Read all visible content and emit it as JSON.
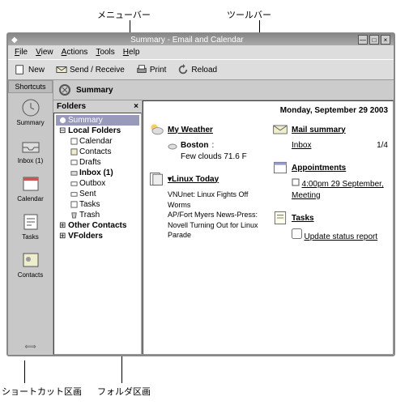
{
  "annotations": {
    "menubar": "メニューバー",
    "toolbar": "ツールバー",
    "shortcuts": "ショートカット区画",
    "folders": "フォルダ区画"
  },
  "window": {
    "title": "Summary - Email and Calendar"
  },
  "menu": {
    "file": "File",
    "view": "View",
    "actions": "Actions",
    "tools": "Tools",
    "help": "Help"
  },
  "tb": {
    "new": "New",
    "sendrecv": "Send / Receive",
    "print": "Print",
    "reload": "Reload"
  },
  "shortcuts": {
    "header": "Shortcuts",
    "items": [
      {
        "label": "Summary"
      },
      {
        "label": "Inbox (1)"
      },
      {
        "label": "Calendar"
      },
      {
        "label": "Tasks"
      },
      {
        "label": "Contacts"
      }
    ]
  },
  "summary": {
    "header": "Summary"
  },
  "folders": {
    "header": "Folders",
    "close": "×",
    "root": "Summary",
    "local": "Local Folders",
    "items": [
      {
        "label": "Calendar"
      },
      {
        "label": "Contacts"
      },
      {
        "label": "Drafts"
      },
      {
        "label": "Inbox (1)",
        "bold": true
      },
      {
        "label": "Outbox"
      },
      {
        "label": "Sent"
      },
      {
        "label": "Tasks"
      },
      {
        "label": "Trash"
      }
    ],
    "other": "Other Contacts",
    "vfolders": "VFolders"
  },
  "pane": {
    "date": "Monday, September 29 2003",
    "weather": {
      "title": "My Weather",
      "city": "Boston",
      "cond": "Few clouds 71.6 F"
    },
    "news": {
      "title": "▾Linux Today",
      "body": "VNUnet: Linux Fights Off Worms\nAP/Fort Myers News-Press: Novell Turning Out for Linux Parade"
    },
    "mail": {
      "title": "Mail summary",
      "folder": "Inbox",
      "count": "1/4"
    },
    "appt": {
      "title": "Appointments",
      "item": "4:00pm 29 September, Meeting"
    },
    "tasks": {
      "title": "Tasks",
      "item": "Update status report"
    }
  }
}
